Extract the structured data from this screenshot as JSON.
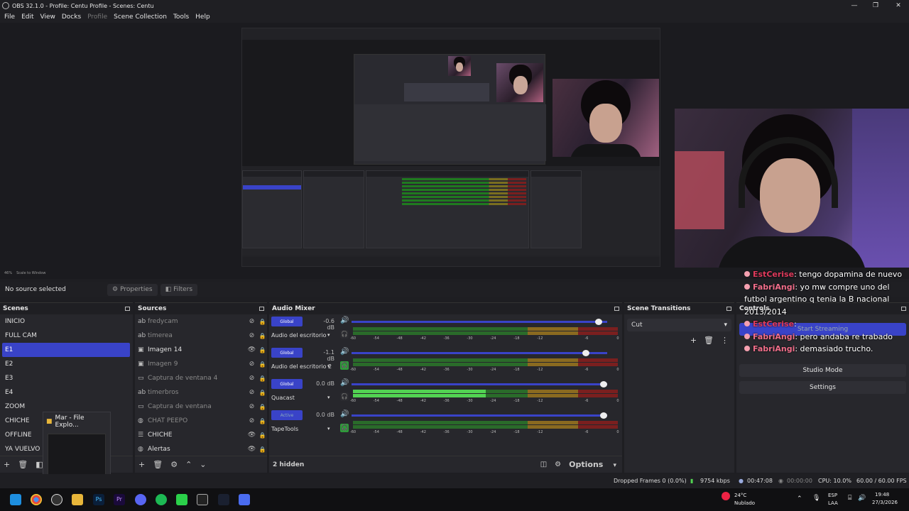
{
  "window": {
    "title": "OBS 32.1.0 - Profile: Centu Profile - Scenes: Centu",
    "minimize": "—",
    "maximize": "❐",
    "close": "✕"
  },
  "menu": {
    "file": "File",
    "edit": "Edit",
    "view": "View",
    "docks": "Docks",
    "profile": "Profile",
    "scene_collection": "Scene Collection",
    "tools": "Tools",
    "help": "Help"
  },
  "preview": {
    "zoom": "46%",
    "scale_mode": "Scale to Window"
  },
  "source_toolbar": {
    "no_source": "No source selected",
    "properties": "Properties",
    "filters": "Filters"
  },
  "scenes": {
    "title": "Scenes",
    "items": [
      "INICIO",
      "FULL CAM",
      "E1",
      "E2",
      "E3",
      "E4",
      "ZOOM",
      "CHICHE",
      "OFFLINE",
      "YA VUELVO"
    ],
    "selected": "E1"
  },
  "file_explorer_popup": {
    "label": "Mar - File Explo..."
  },
  "sources": {
    "title": "Sources",
    "items": [
      {
        "icon": "text-icon",
        "glyph": "ab",
        "name": "fredycam",
        "visible": false
      },
      {
        "icon": "text-icon",
        "glyph": "ab",
        "name": "timerea",
        "visible": false
      },
      {
        "icon": "image-icon",
        "glyph": "▣",
        "name": "Imagen 14",
        "visible": true
      },
      {
        "icon": "image-icon",
        "glyph": "▣",
        "name": "Imagen 9",
        "visible": false
      },
      {
        "icon": "window-capture-icon",
        "glyph": "▭",
        "name": "Captura de ventana 4",
        "visible": false
      },
      {
        "icon": "text-icon",
        "glyph": "ab",
        "name": "timerbros",
        "visible": false
      },
      {
        "icon": "window-capture-icon",
        "glyph": "▭",
        "name": "Captura de ventana",
        "visible": false
      },
      {
        "icon": "browser-icon",
        "glyph": "◍",
        "name": "CHAT PEEPO",
        "visible": false
      },
      {
        "icon": "group-icon",
        "glyph": "☰",
        "name": "CHICHE",
        "visible": true
      },
      {
        "icon": "browser-icon",
        "glyph": "◍",
        "name": "Alertas",
        "visible": true
      }
    ]
  },
  "audio_mixer": {
    "title": "Audio Mixer",
    "channels": [
      {
        "tag": "Global",
        "db": "-0.6 dB",
        "name": "Audio del escritorio",
        "monitor": false,
        "volume": 0.98,
        "level": 0.0
      },
      {
        "tag": "Global",
        "db": "-1.1 dB",
        "name": "Audio del escritorio 2",
        "monitor": true,
        "volume": 0.93,
        "level": 0.0
      },
      {
        "tag": "Global",
        "db": "0.0 dB",
        "name": "Quacast",
        "monitor": false,
        "volume": 1.0,
        "level": 0.5
      },
      {
        "tag": "Active",
        "db": "0.0 dB",
        "name": "TapeTools",
        "monitor": true,
        "volume": 1.0,
        "level": 0.0
      }
    ],
    "scale": [
      "-60",
      "-54",
      "-48",
      "-42",
      "-36",
      "-30",
      "-24",
      "-18",
      "-12",
      "-6",
      "0"
    ],
    "hidden": "2 hidden",
    "options": "Options"
  },
  "scene_transitions": {
    "title": "Scene Transitions",
    "selected": "Cut"
  },
  "controls": {
    "title": "Controls",
    "start_streaming": "Start Streaming",
    "studio_mode": "Studio Mode",
    "settings": "Settings"
  },
  "chat": [
    {
      "user": "EstCerise",
      "text": ": tengo dopamina de nuevo"
    },
    {
      "user": "FabriAngi",
      "text": ": yo mw compre uno del futbol argentino q tenia la B nacional 2013/2014"
    },
    {
      "user": "EstCerise",
      "text": ":"
    },
    {
      "user": "FabriAngi",
      "text": ": pero andaba re trabado"
    },
    {
      "user": "FabriAngi",
      "text": ": demasiado trucho."
    }
  ],
  "statusbar": {
    "dropped": "Dropped Frames 0 (0.0%)",
    "bitrate": "9754 kbps",
    "rec_time": "00:47:08",
    "stream_time": "00:00:00",
    "cpu": "CPU: 10.0%",
    "fps": "60.00 / 60.00 FPS"
  },
  "taskbar": {
    "weather_temp": "24°C",
    "weather_desc": "Nublado",
    "lang1": "ESP",
    "lang2": "LAA",
    "time": "19:48",
    "date": "27/3/2026"
  }
}
